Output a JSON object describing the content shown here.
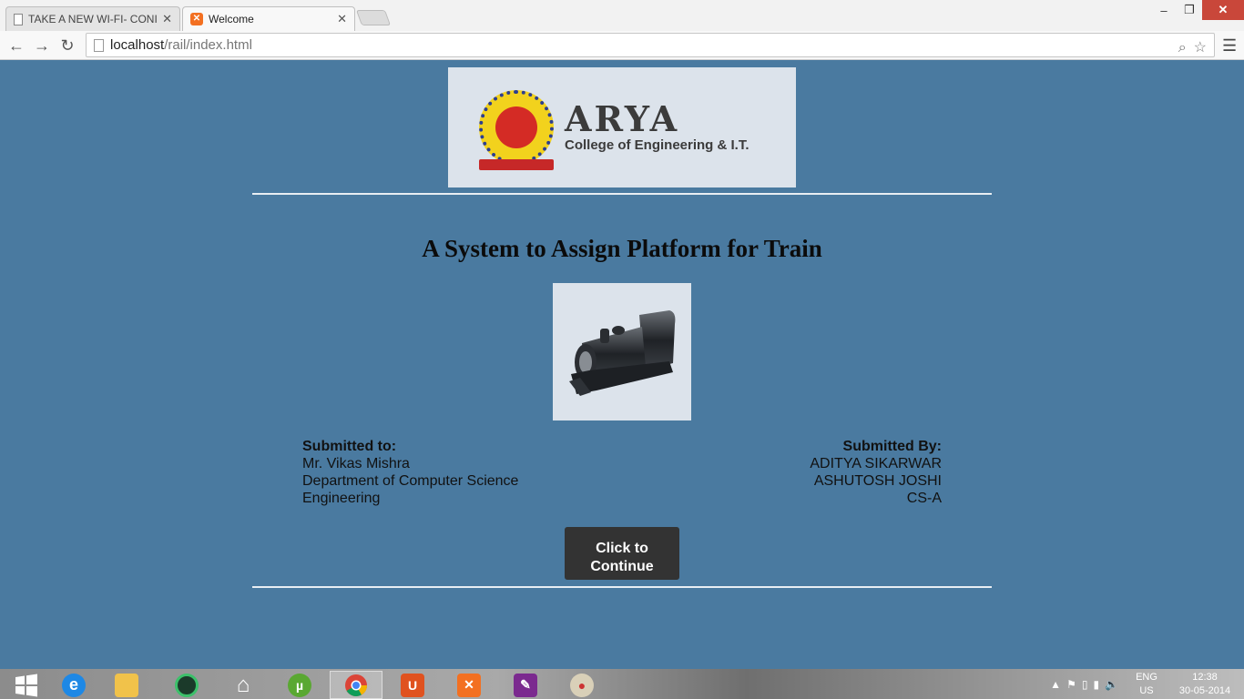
{
  "browser": {
    "tabs": [
      {
        "title": "TAKE A NEW WI-FI- CONI",
        "active": false
      },
      {
        "title": "Welcome",
        "active": true
      }
    ],
    "url_host": "localhost",
    "url_path": "/rail/index.html"
  },
  "page": {
    "logo": {
      "name": "ARYA",
      "subtitle": "College of Engineering & I.T."
    },
    "title": "A System to Assign Platform for Train",
    "submitted_to": {
      "label": "Submitted to:",
      "name": "Mr. Vikas Mishra",
      "dept_line1": "Department of Computer Science",
      "dept_line2": "Engineering"
    },
    "submitted_by": {
      "label": "Submitted By:",
      "member1": "ADITYA SIKARWAR",
      "member2": "ASHUTOSH JOSHI",
      "section": "CS-A"
    },
    "continue_button": {
      "line1": "Click to",
      "line2": "Continue"
    }
  },
  "taskbar": {
    "apps": [
      "start",
      "internet-explorer",
      "file-explorer",
      "media-app",
      "home",
      "utorrent",
      "chrome",
      "html-editor",
      "xampp",
      "notepad-app",
      "paint"
    ],
    "lang_line1": "ENG",
    "lang_line2": "US",
    "time": "12:38",
    "date": "30-05-2014"
  }
}
